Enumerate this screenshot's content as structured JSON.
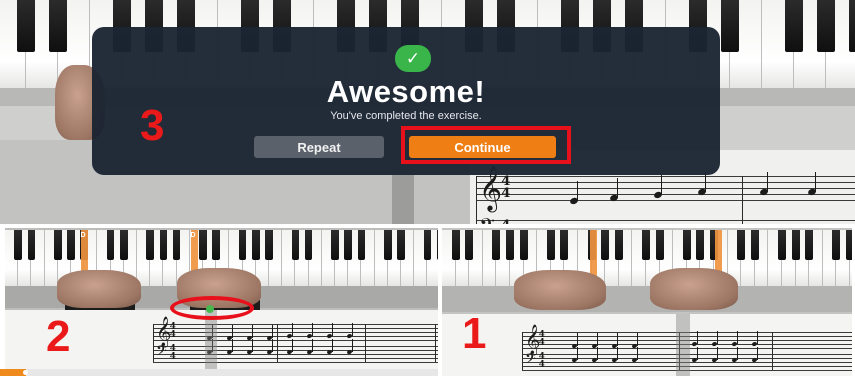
{
  "modal": {
    "check_icon": "✓",
    "title": "Awesome!",
    "subtitle": "You've completed the exercise.",
    "repeat_label": "Repeat",
    "continue_label": "Continue"
  },
  "annotations": {
    "step_top": "3",
    "step_bottom_left": "2",
    "step_bottom_right": "1"
  },
  "keyboard_labels": {
    "left_key_1": "D",
    "left_key_2": "D"
  },
  "sheet_music": {
    "measure_number": "2",
    "time_signature_top": "4",
    "time_signature_bottom": "4",
    "treble_clef": "𝄞",
    "bass_clef": "𝄢"
  },
  "progress": {
    "value": 0.06
  },
  "colors": {
    "highlight_orange": "#f0923f",
    "continue_orange": "#ef7e14",
    "annotation_red": "#e8111b",
    "success_green": "#39b54a",
    "modal_bg": "#1b2432"
  },
  "icons": {
    "check": "check-icon",
    "treble": "treble-clef-icon",
    "bass": "bass-clef-icon"
  }
}
